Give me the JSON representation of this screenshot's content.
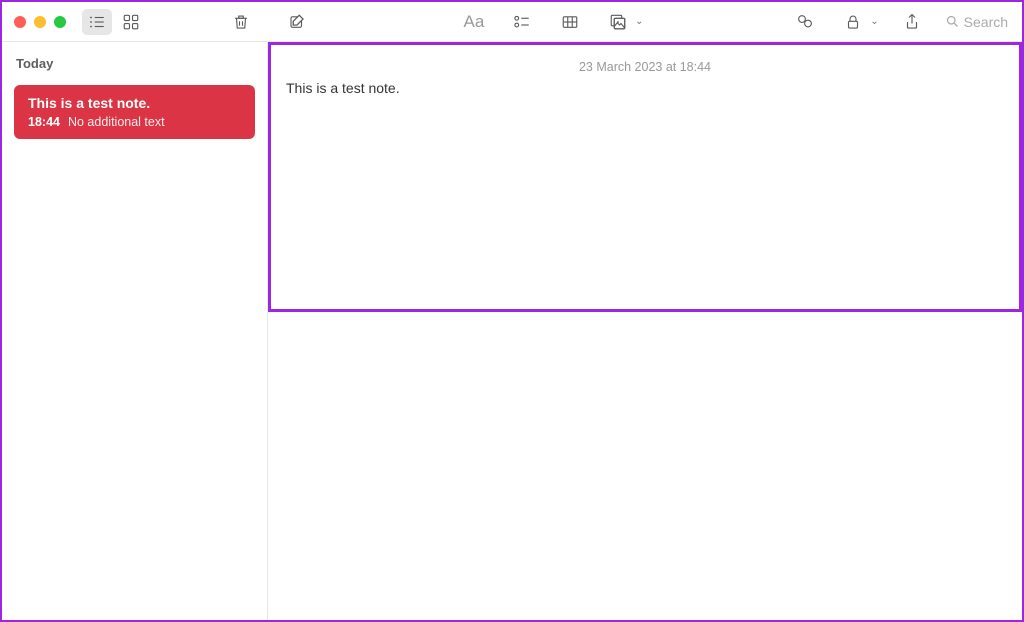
{
  "sidebar": {
    "section_label": "Today",
    "notes": [
      {
        "title": "This is a test note.",
        "time": "18:44",
        "preview": "No additional text"
      }
    ]
  },
  "editor": {
    "timestamp": "23 March 2023 at 18:44",
    "content": "This is a test note."
  },
  "toolbar": {
    "search_placeholder": "Search"
  },
  "colors": {
    "selection_red": "#db3444",
    "highlight_purple": "#9c27e0"
  }
}
